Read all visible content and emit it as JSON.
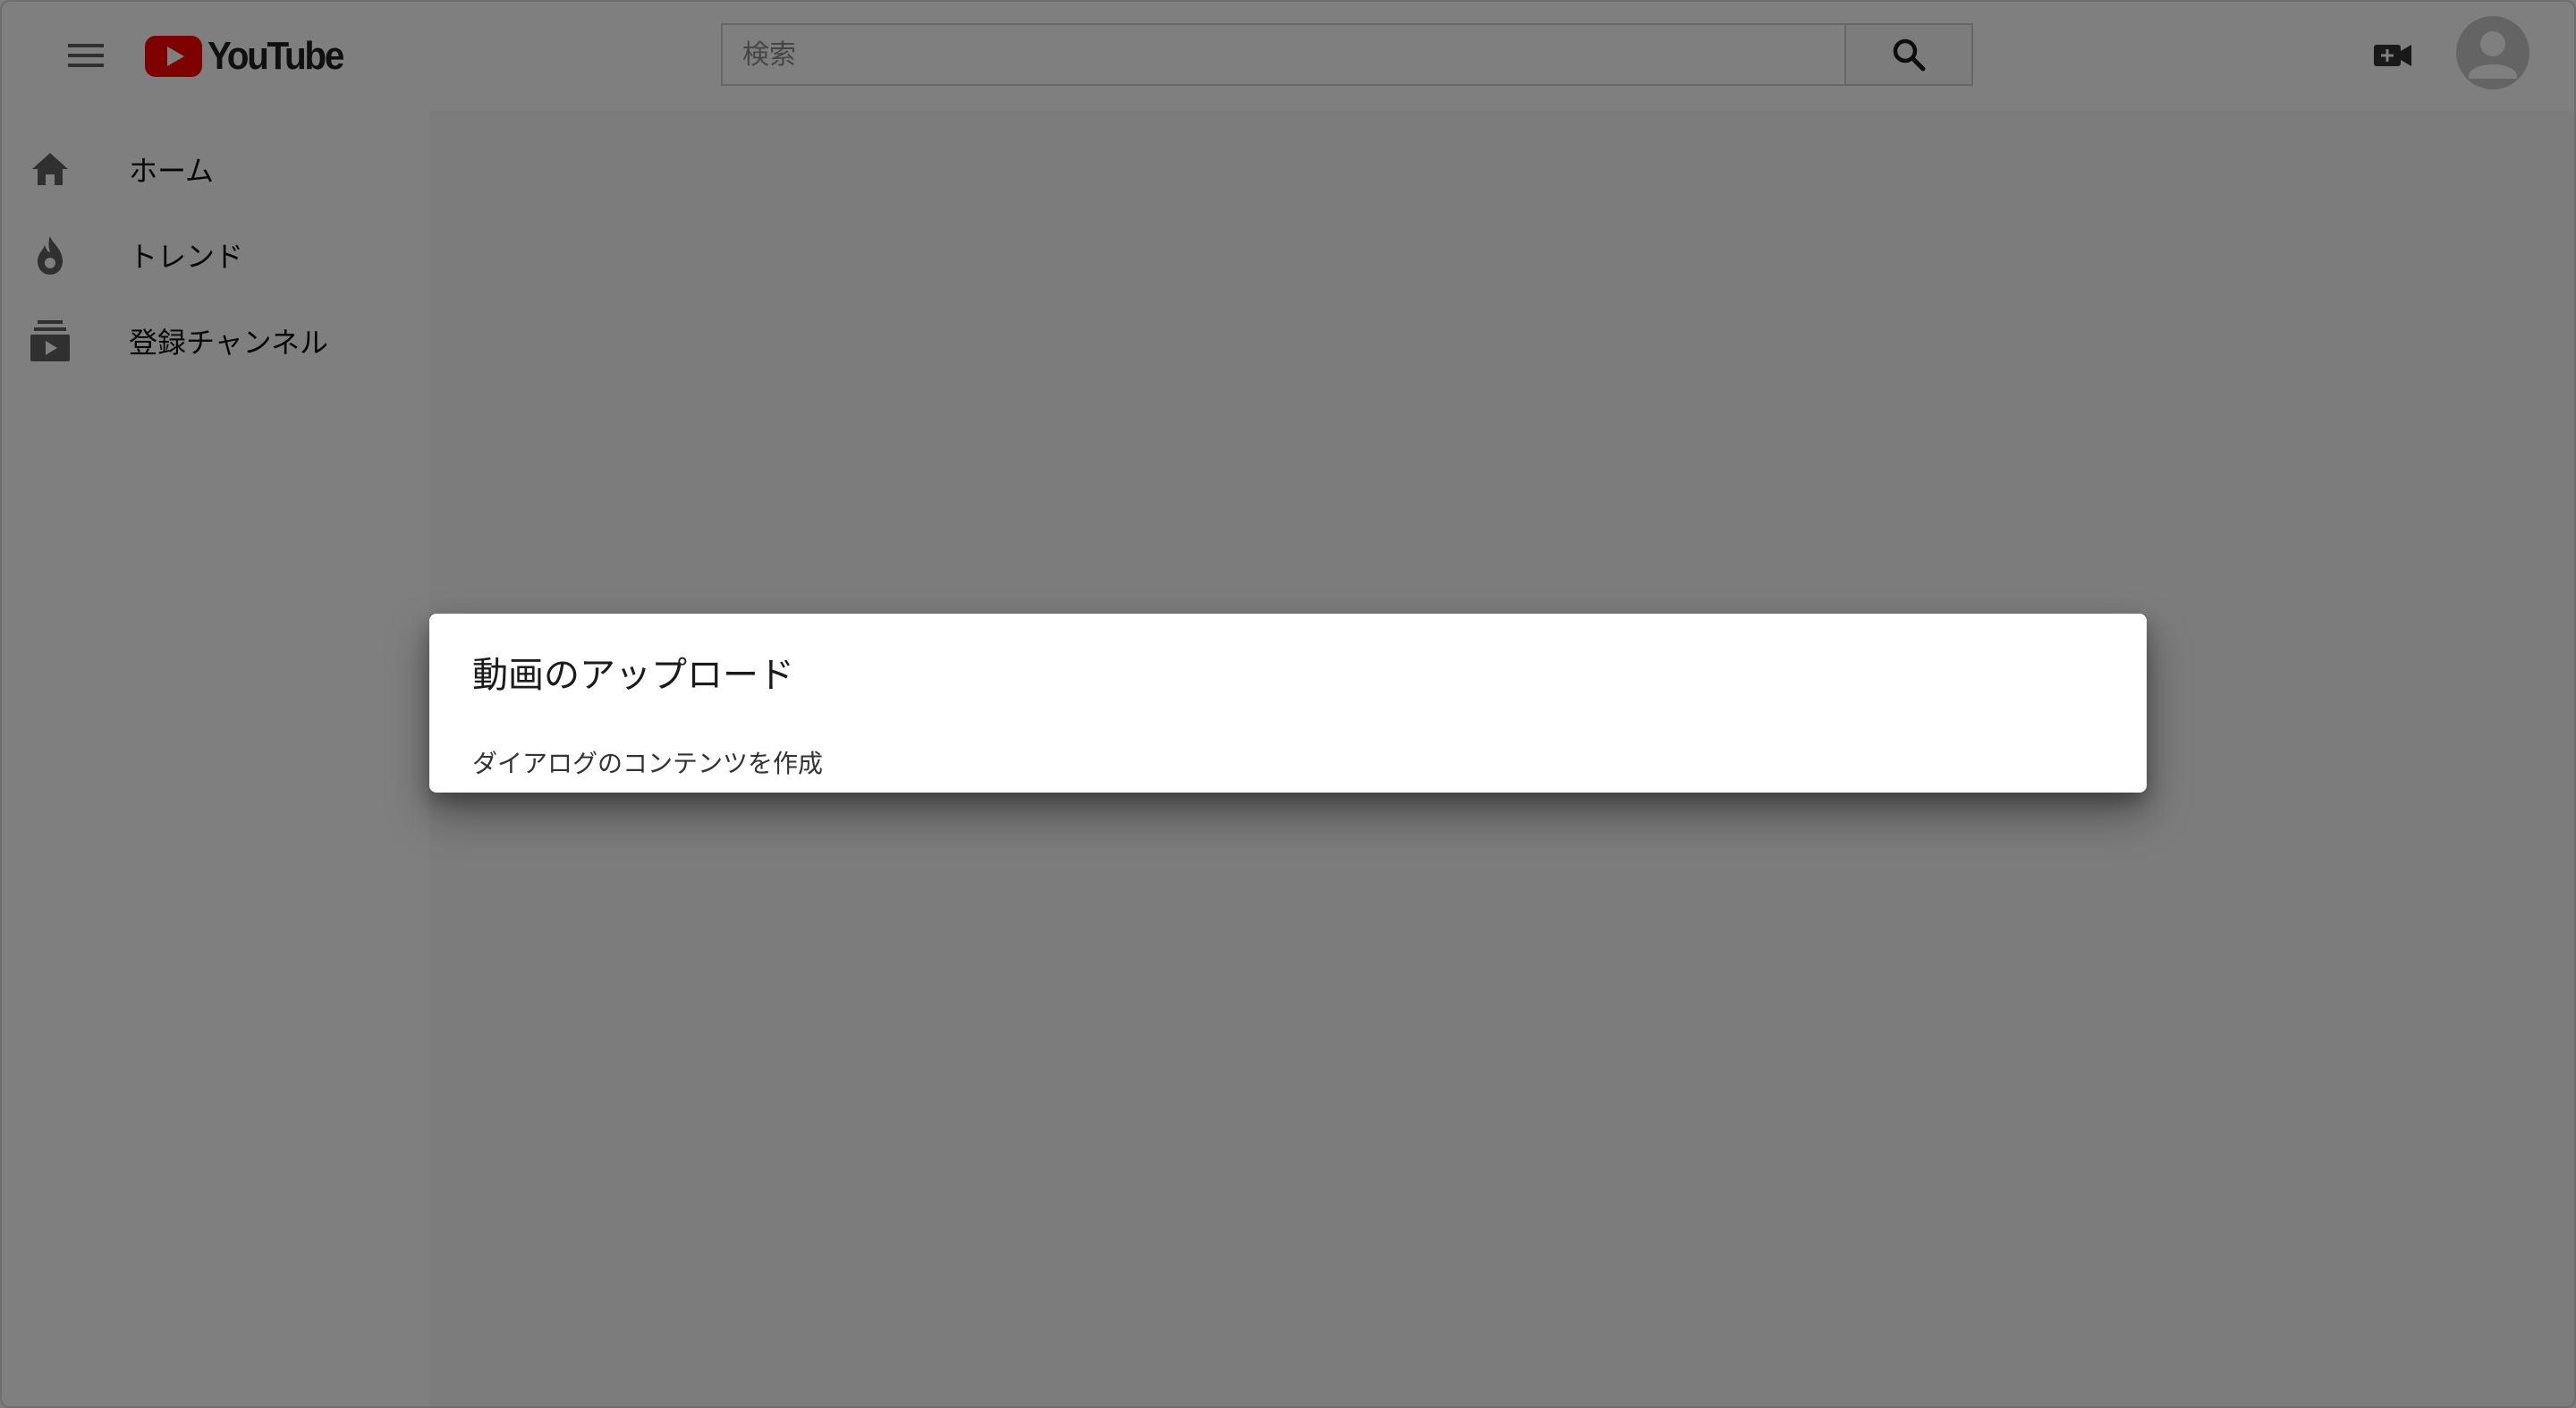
{
  "header": {
    "logo_text": "YouTube",
    "logo_icon": "youtube-play-icon",
    "menu_icon": "hamburger-menu-icon",
    "search": {
      "placeholder": "検索",
      "value": "",
      "button_icon": "search-icon"
    },
    "upload_icon": "video-camera-add-icon",
    "avatar_icon": "account-avatar-icon"
  },
  "sidebar": {
    "items": [
      {
        "label": "ホーム",
        "icon": "home-icon"
      },
      {
        "label": "トレンド",
        "icon": "flame-icon"
      },
      {
        "label": "登録チャンネル",
        "icon": "subscriptions-icon"
      }
    ]
  },
  "dialog": {
    "title": "動画のアップロード",
    "body": "ダイアログのコンテンツを作成"
  },
  "colors": {
    "youtube_red": "#ff0000",
    "icon_gray": "#606060",
    "backdrop": "rgba(0,0,0,0.5)"
  }
}
